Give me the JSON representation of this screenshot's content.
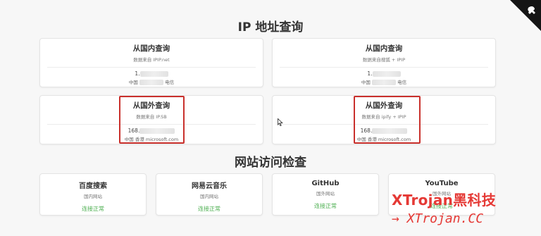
{
  "ip_section": {
    "title": "IP 地址查询",
    "cards": [
      {
        "title": "从国内查询",
        "source": "数据来自 IPIP.net",
        "ip_prefix": "1.",
        "location_prefix": "中国",
        "location_suffix": "电信"
      },
      {
        "title": "从国内查询",
        "source": "数据来自搜狐 + IPIP",
        "ip_prefix": "1.",
        "location_prefix": "中国",
        "location_suffix": "电信"
      },
      {
        "title": "从国外查询",
        "source": "数据来自 IP.SB",
        "ip_prefix": "168.",
        "location_prefix": "中国 香港 microsoft.com",
        "location_suffix": ""
      },
      {
        "title": "从国外查询",
        "source": "数据来自 ipify + IPIP",
        "ip_prefix": "168.",
        "location_prefix": "中国 香港 microsoft.com",
        "location_suffix": ""
      }
    ]
  },
  "site_section": {
    "title": "网站访问检查",
    "cards": [
      {
        "title": "百度搜索",
        "category": "国内网站",
        "status": "连接正常"
      },
      {
        "title": "网易云音乐",
        "category": "国内网站",
        "status": "连接正常"
      },
      {
        "title": "GitHub",
        "category": "国外网站",
        "status": "连接正常"
      },
      {
        "title": "YouTube",
        "category": "国外网站",
        "status": "连接正常"
      }
    ]
  },
  "watermark": {
    "line1": "XTrojan黑科技",
    "line2": "→ XTrojan.CC"
  },
  "colors": {
    "status_ok": "#4caf50",
    "highlight": "#c9302c",
    "watermark": "#e53935"
  },
  "icons": {
    "corner": "github-corner-icon"
  }
}
